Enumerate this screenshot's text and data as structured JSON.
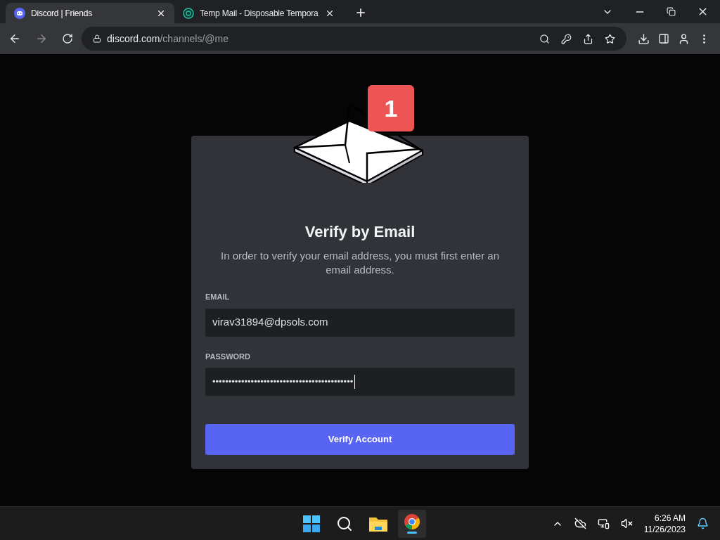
{
  "browser": {
    "tabs": [
      {
        "title": "Discord | Friends",
        "selected": true,
        "kind": "discord"
      },
      {
        "title": "Temp Mail - Disposable Tempora",
        "selected": false,
        "kind": "tempmail"
      }
    ],
    "url_host": "discord.com",
    "url_path": "/channels/@me"
  },
  "modal": {
    "badge": "1",
    "title": "Verify by Email",
    "description": "In order to verify your email address, you must first enter an email address.",
    "fields": [
      {
        "label": "EMAIL",
        "value": "virav31894@dpsols.com",
        "kind": "text"
      },
      {
        "label": "PASSWORD",
        "value": "••••••••••••••••••••••••••••••••••••••••••••",
        "kind": "password"
      }
    ],
    "button": "Verify Account"
  },
  "taskbar": {
    "time": "6:26 AM",
    "date": "11/26/2023"
  }
}
